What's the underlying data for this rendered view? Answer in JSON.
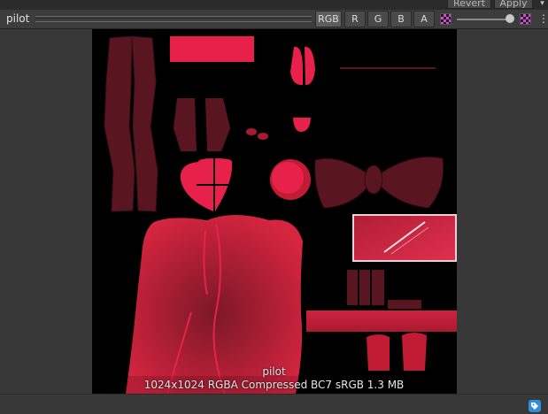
{
  "header": {
    "revert_label": "Revert",
    "apply_label": "Apply",
    "menu_glyph": "▾"
  },
  "toolbar": {
    "title": "pilot",
    "channels": [
      "RGB",
      "R",
      "G",
      "B",
      "A"
    ],
    "active_channel": "RGB",
    "mip_icon": "checker-icon",
    "alpha_icon": "checker-icon",
    "more_glyph": "⋮"
  },
  "preview": {
    "name": "pilot",
    "info": "1024x1024  RGBA Compressed BC7 sRGB  1.3 MB",
    "accent": "#e8214a",
    "dark_accent": "#6b1722"
  },
  "status": {
    "tag_icon": "tag-icon",
    "tag_color": "#2f8de0"
  }
}
